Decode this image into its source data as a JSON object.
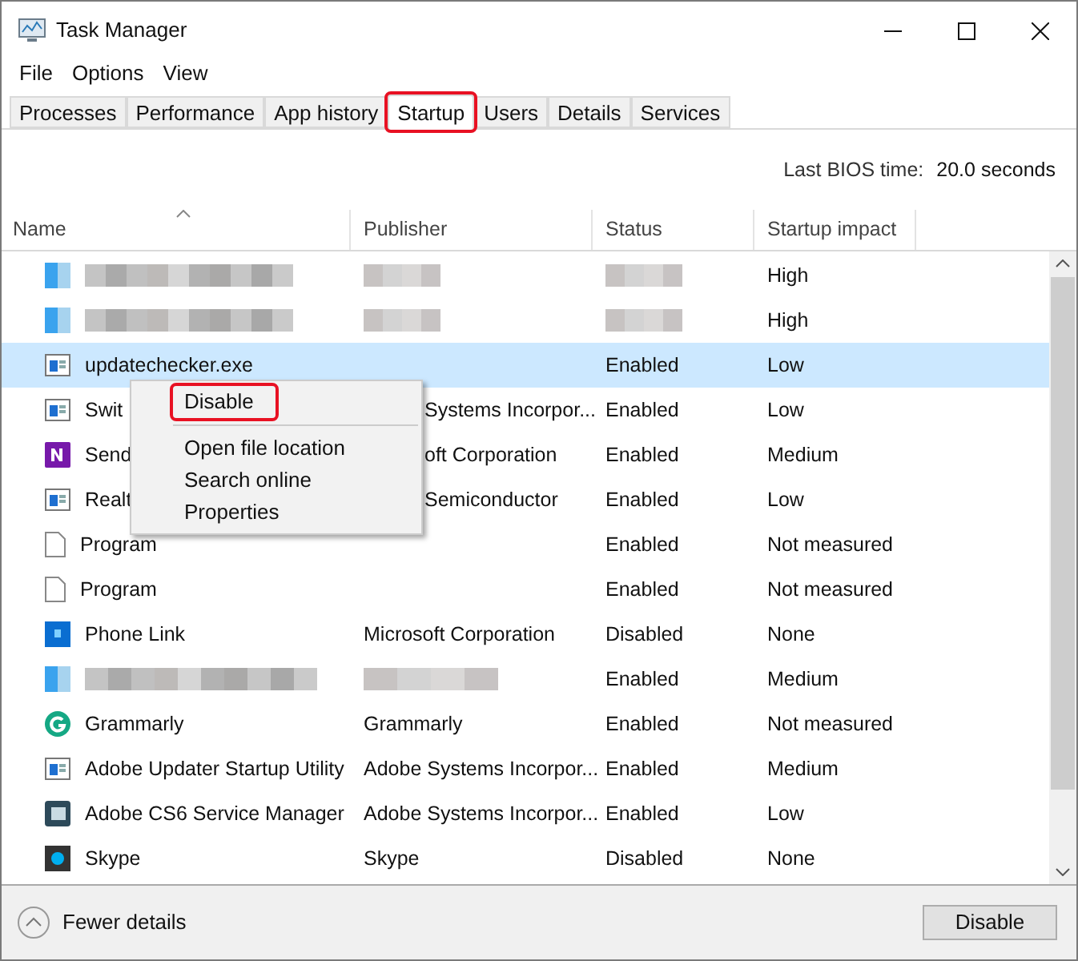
{
  "window": {
    "title": "Task Manager"
  },
  "menu": [
    "File",
    "Options",
    "View"
  ],
  "tabs": [
    {
      "label": "Processes",
      "selected": false,
      "highlighted": false
    },
    {
      "label": "Performance",
      "selected": false,
      "highlighted": false
    },
    {
      "label": "App history",
      "selected": false,
      "highlighted": false
    },
    {
      "label": "Startup",
      "selected": true,
      "highlighted": true
    },
    {
      "label": "Users",
      "selected": false,
      "highlighted": false
    },
    {
      "label": "Details",
      "selected": false,
      "highlighted": false
    },
    {
      "label": "Services",
      "selected": false,
      "highlighted": false
    }
  ],
  "bios": {
    "label": "Last BIOS time:",
    "value": "20.0 seconds"
  },
  "table": {
    "columns": [
      {
        "label": "Name",
        "sorted": true
      },
      {
        "label": "Publisher",
        "sorted": false
      },
      {
        "label": "Status",
        "sorted": false
      },
      {
        "label": "Startup impact",
        "sorted": false
      }
    ],
    "rows": [
      {
        "kind": "blurred",
        "impact": "High",
        "selected": false
      },
      {
        "kind": "blurred",
        "impact": "High",
        "selected": false
      },
      {
        "kind": "window",
        "name": "updatechecker.exe",
        "status": "Enabled",
        "impact": "Low",
        "selected": true
      },
      {
        "kind": "window",
        "name": "Swit",
        "publisher": "Systems Incorpor...",
        "status": "Enabled",
        "impact": "Low",
        "selected": false,
        "covered": true
      },
      {
        "kind": "onenote",
        "name": "Send",
        "publisher": "oft Corporation",
        "status": "Enabled",
        "impact": "Medium",
        "selected": false,
        "covered": true
      },
      {
        "kind": "window",
        "name": "Realt",
        "publisher": "Semiconductor",
        "status": "Enabled",
        "impact": "Low",
        "selected": false,
        "covered": true
      },
      {
        "kind": "file",
        "name": "Program",
        "status": "Enabled",
        "impact": "Not measured",
        "selected": false
      },
      {
        "kind": "file",
        "name": "Program",
        "status": "Enabled",
        "impact": "Not measured",
        "selected": false
      },
      {
        "kind": "phone",
        "name": "Phone Link",
        "publisher": "Microsoft Corporation",
        "status": "Disabled",
        "impact": "None",
        "selected": false,
        "covered": false
      },
      {
        "kind": "blurred",
        "status": "Enabled",
        "impact": "Medium",
        "selected": false
      },
      {
        "kind": "grammarly",
        "name": "Grammarly",
        "publisher": "Grammarly",
        "status": "Enabled",
        "impact": "Not measured",
        "selected": false,
        "covered": false
      },
      {
        "kind": "window",
        "name": "Adobe Updater Startup Utility",
        "publisher": "Adobe Systems Incorpor...",
        "status": "Enabled",
        "impact": "Medium",
        "selected": false,
        "covered": false
      },
      {
        "kind": "cs6",
        "name": "Adobe CS6 Service Manager",
        "publisher": "Adobe Systems Incorpor...",
        "status": "Enabled",
        "impact": "Low",
        "selected": false,
        "covered": false
      },
      {
        "kind": "skype",
        "name": "Skype",
        "publisher": "Skype",
        "status": "Disabled",
        "impact": "None",
        "selected": false,
        "covered": false
      }
    ]
  },
  "context_menu": {
    "items": [
      {
        "label": "Disable",
        "highlighted": true,
        "separator_after": true
      },
      {
        "label": "Open file location",
        "highlighted": false,
        "separator_after": false
      },
      {
        "label": "Search online",
        "highlighted": false,
        "separator_after": false
      },
      {
        "label": "Properties",
        "highlighted": false,
        "separator_after": false
      }
    ]
  },
  "footer": {
    "toggle": "Fewer details",
    "button": "Disable"
  }
}
